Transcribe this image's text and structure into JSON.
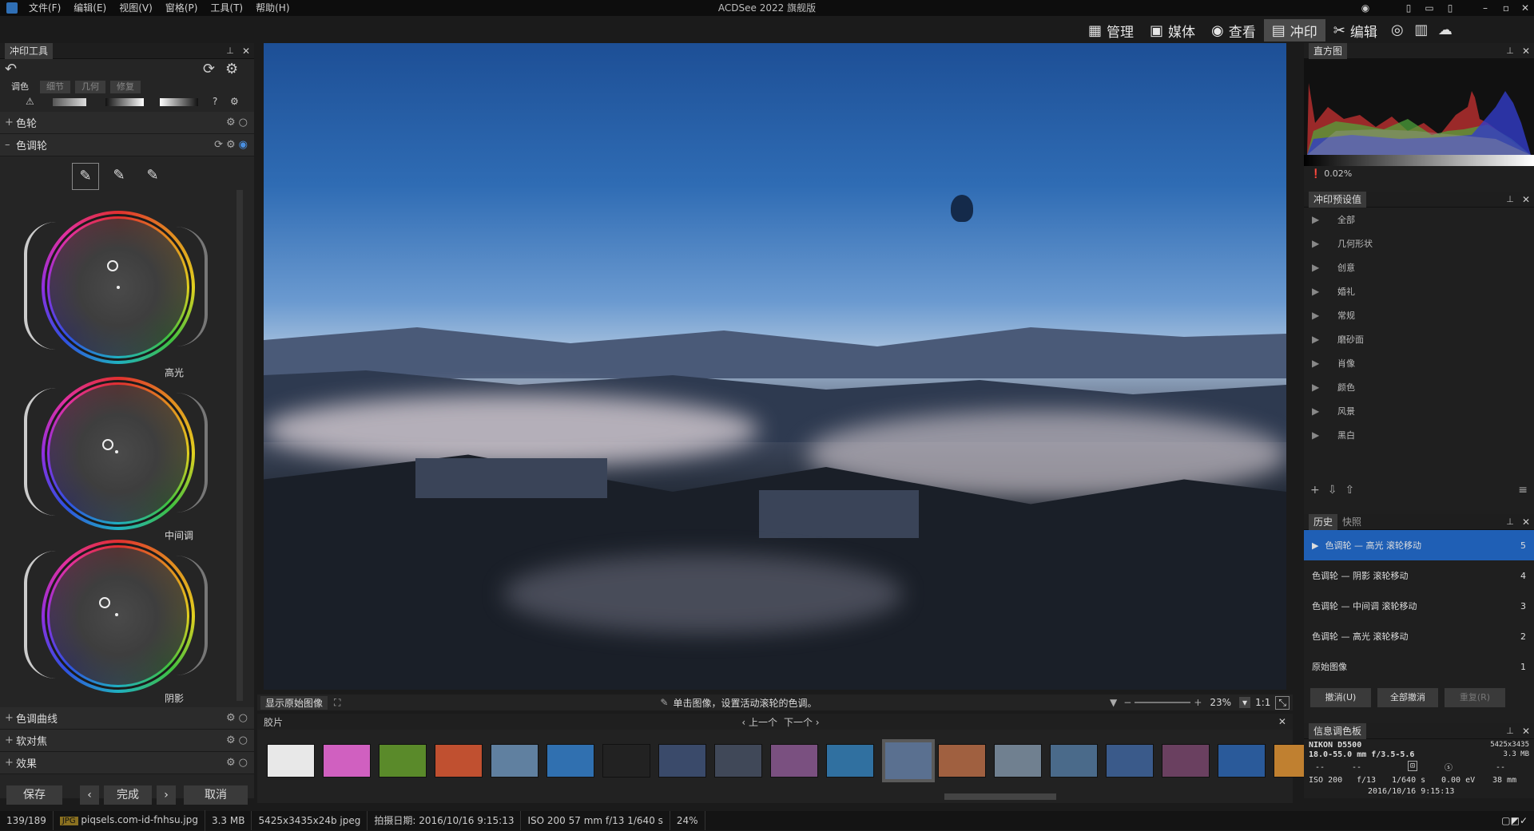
{
  "titlebar": {
    "menus": [
      "文件(F)",
      "编辑(E)",
      "视图(V)",
      "窗格(P)",
      "工具(T)",
      "帮助(H)"
    ],
    "title": "ACDSee 2022 旗舰版"
  },
  "modes": [
    {
      "icon": "grid-icon",
      "label": "管理"
    },
    {
      "icon": "media-icon",
      "label": "媒体"
    },
    {
      "icon": "eye-icon",
      "label": "查看"
    },
    {
      "icon": "develop-icon",
      "label": "冲印",
      "active": true
    },
    {
      "icon": "edit-icon",
      "label": "编辑"
    }
  ],
  "left_panel": {
    "title": "冲印工具",
    "tabs": [
      "调色",
      "细节",
      "几何",
      "修复"
    ],
    "sections": {
      "color_wheel": "色轮",
      "tone_wheels": "色调轮",
      "tone_curves": "色调曲线",
      "soft_focus": "软对焦",
      "effects": "效果"
    },
    "wheel_labels": [
      "高光",
      "中间调",
      "阴影"
    ],
    "buttons": {
      "save": "保存",
      "done": "完成",
      "cancel": "取消"
    }
  },
  "viewer": {
    "show_original": "显示原始图像",
    "hint": "单击图像，设置活动滚轮的色调。",
    "zoom": "23%",
    "ratio": "1:1"
  },
  "filmstrip": {
    "title": "胶片",
    "prev": "上一个",
    "next": "下一个",
    "thumb_colors": [
      "#e8e8e8",
      "#d060c0",
      "#5a8a2a",
      "#c05030",
      "#6080a0",
      "#3070b0",
      "#222",
      "#3a4a6a",
      "#404858",
      "#7a5080",
      "#3070a0",
      "#5a7090",
      "#a06040",
      "#708090",
      "#4a6a8a",
      "#3a5a8a",
      "#6a4060",
      "#2a5a9a",
      "#c08030"
    ],
    "selected_index": 11
  },
  "histogram": {
    "title": "直方图",
    "clip": "0.02%"
  },
  "presets": {
    "title": "冲印预设值",
    "items": [
      "全部",
      "几何形状",
      "创意",
      "婚礼",
      "常规",
      "磨砂面",
      "肖像",
      "颜色",
      "风景",
      "黑白"
    ]
  },
  "history": {
    "tabs": [
      "历史",
      "快照"
    ],
    "items": [
      {
        "label": "色调轮 — 高光 滚轮移动",
        "n": "5"
      },
      {
        "label": "色调轮 — 阴影 滚轮移动",
        "n": "4"
      },
      {
        "label": "色调轮 — 中间调 滚轮移动",
        "n": "3"
      },
      {
        "label": "色调轮 — 高光 滚轮移动",
        "n": "2"
      },
      {
        "label": "原始图像",
        "n": "1"
      }
    ],
    "buttons": {
      "undo": "撤消(U)",
      "undo_all": "全部撤消",
      "redo": "重复(R)"
    }
  },
  "info_palette": {
    "title": "信息调色板",
    "camera": "NIKON D5500",
    "dims": "5425x3435",
    "size": "3.3 MB",
    "lens": "18.0-55.0 mm f/3.5-5.6",
    "dashes": [
      "--",
      "--",
      "--"
    ],
    "iso": "ISO 200",
    "fnum": "f/13",
    "shutter": "1/640 s",
    "ev": "0.00 eV",
    "focal": "38 mm",
    "datetime": "2016/10/16 9:15:13"
  },
  "status": {
    "index": "139/189",
    "type": "JPG",
    "filename": "piqsels.com-id-fnhsu.jpg",
    "filesize": "3.3 MB",
    "format": "5425x3435x24b jpeg",
    "taken": "拍摄日期: 2016/10/16 9:15:13",
    "exif": "ISO 200   57 mm   f/13   1/640 s",
    "zoom": "24%"
  }
}
